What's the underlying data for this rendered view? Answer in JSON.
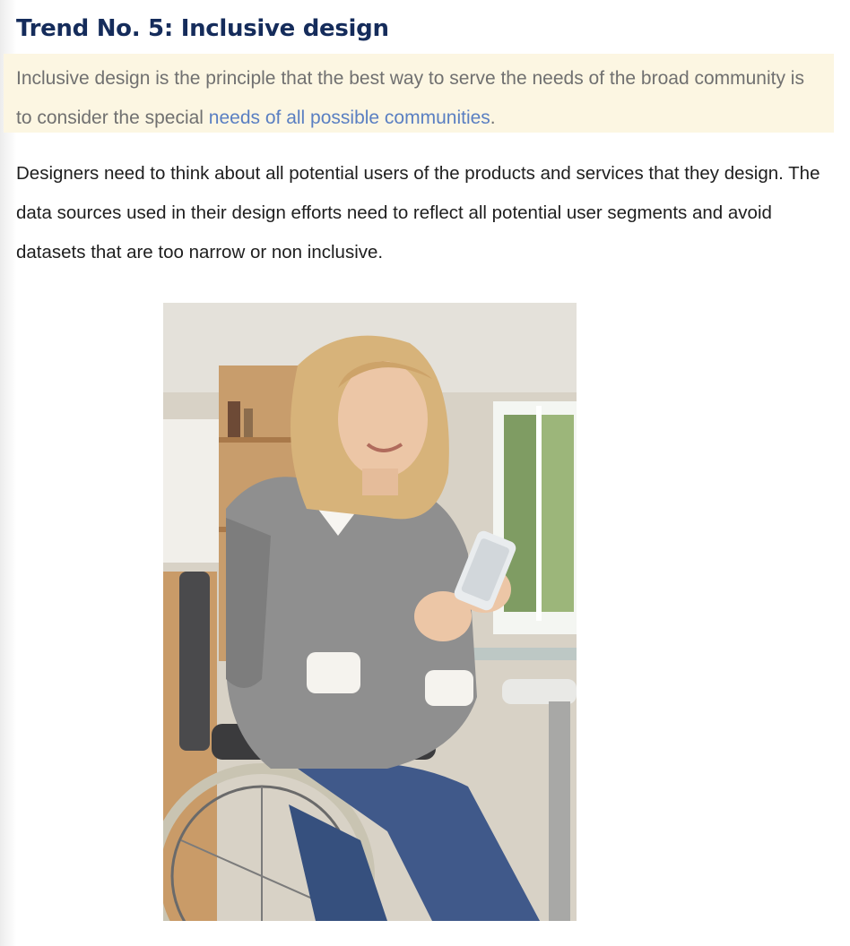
{
  "article": {
    "heading": "Trend No. 5: Inclusive design",
    "callout": {
      "text_before": "Inclusive design is the principle that the best way to serve the needs of the broad community is to consider the special ",
      "link_text": "needs of all possible communities",
      "text_after": "."
    },
    "paragraph": "Designers need to think about all potential users of the products and services that they design. The data sources used in their design efforts need to reflect all potential user segments and avoid datasets that are too narrow or non inclusive."
  },
  "colors": {
    "heading": "#152c5b",
    "callout_background": "#fcf6e2",
    "callout_text": "#707070",
    "link": "#5a7fc2",
    "body_text": "#1e1e1e"
  }
}
